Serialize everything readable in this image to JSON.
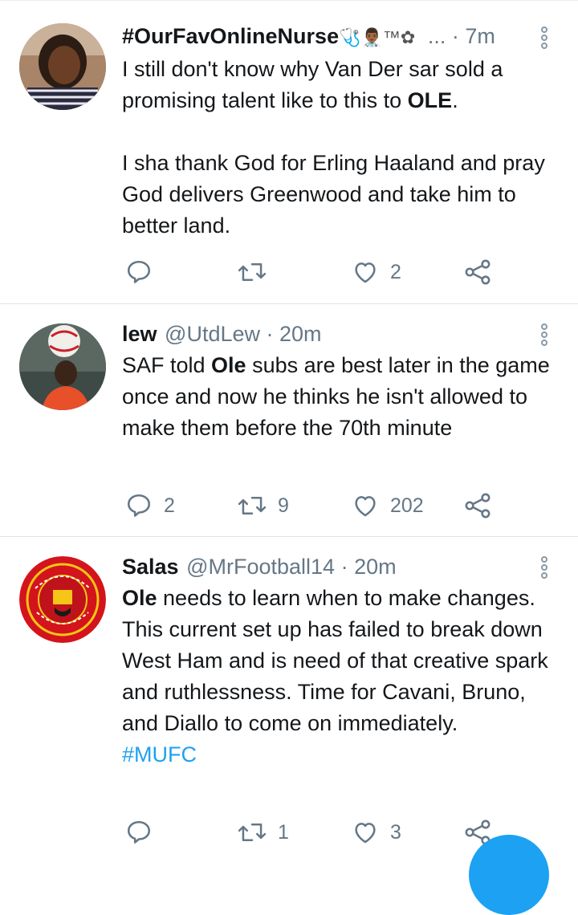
{
  "tweets": [
    {
      "name": "#OurFavOnlineNurse",
      "name_emojis": "🩺👨🏾‍⚕️™✿",
      "handle": "...",
      "time": "· 7m",
      "body_lines": [
        "I still don't know why Van Der sar sold a promising talent like to this to ",
        "OLE",
        ".",
        "I sha thank God for Erling Haaland and pray God delivers Greenwood and take him to better land."
      ],
      "actions": {
        "reply": "",
        "retweet": "",
        "like": "2"
      }
    },
    {
      "name": "lew",
      "handle": "@UtdLew",
      "time": "· 20m",
      "body_lines": [
        "SAF told ",
        "Ole",
        " subs are best later in the game once and now he thinks he isn't allowed to make them before the 70th minute"
      ],
      "actions": {
        "reply": "2",
        "retweet": "9",
        "like": "202"
      }
    },
    {
      "name": "Salas",
      "handle": "@MrFootball14",
      "time": "· 20m",
      "body_lines": [
        "Ole",
        " needs to learn when to make changes. This current set up has failed to break down West Ham and is need of that creative spark and ruthlessness. Time for Cavani, Bruno, and Diallo to come on immediately."
      ],
      "hashtag": "#MUFC",
      "actions": {
        "reply": "",
        "retweet": "1",
        "like": "3"
      }
    }
  ],
  "colors": {
    "accent": "#1da1f2",
    "muted": "#657786",
    "text": "#14171a"
  },
  "icons": [
    "reply-icon",
    "retweet-icon",
    "like-icon",
    "share-icon",
    "more-options-icon",
    "compose-fab"
  ]
}
